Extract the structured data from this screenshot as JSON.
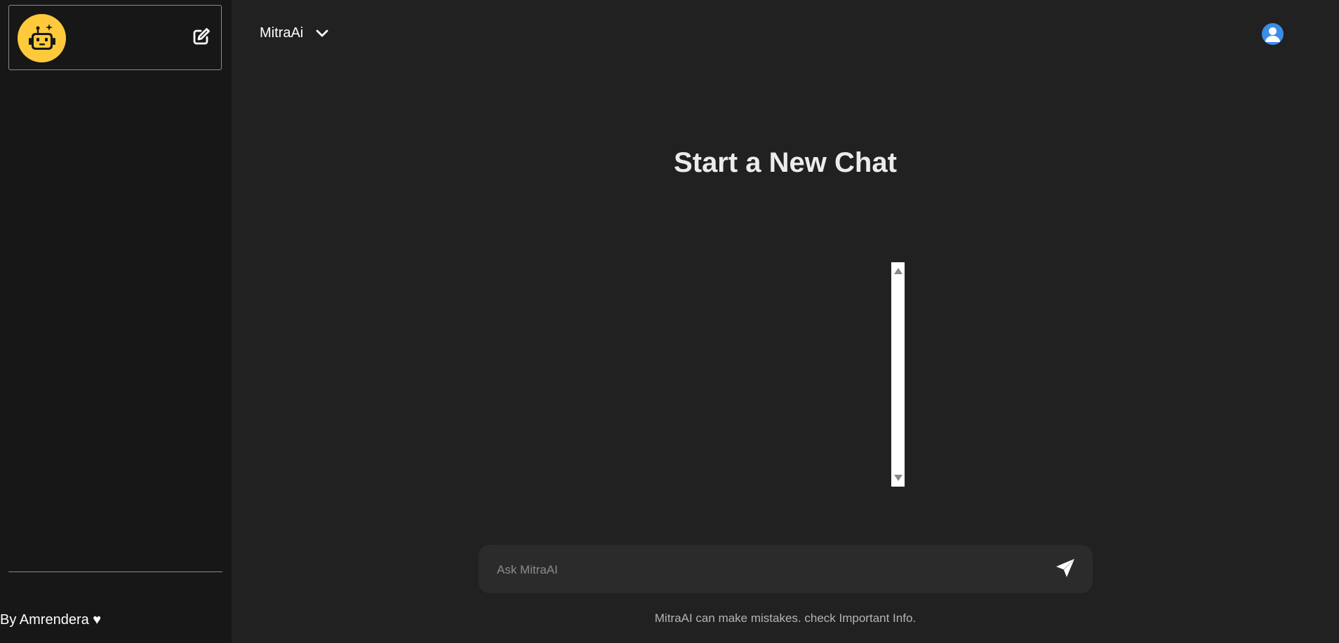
{
  "sidebar": {
    "logo_icon": "robot-icon",
    "new_chat_icon": "edit-icon",
    "footer_text": "By Amrendera ♥"
  },
  "header": {
    "model_name": "MitraAi",
    "dropdown_icon": "chevron-down-icon",
    "user_icon": "user-icon"
  },
  "main": {
    "title": "Start a New Chat"
  },
  "composer": {
    "placeholder": "Ask MitraAI",
    "send_icon": "send-icon"
  },
  "disclaimer": "MitraAI can make mistakes. check Important Info.",
  "colors": {
    "background": "#212121",
    "sidebar": "#171717",
    "accent_logo": "#ffc93c",
    "user_avatar": "#3b8de8",
    "input_bg": "#2b2b2b"
  }
}
